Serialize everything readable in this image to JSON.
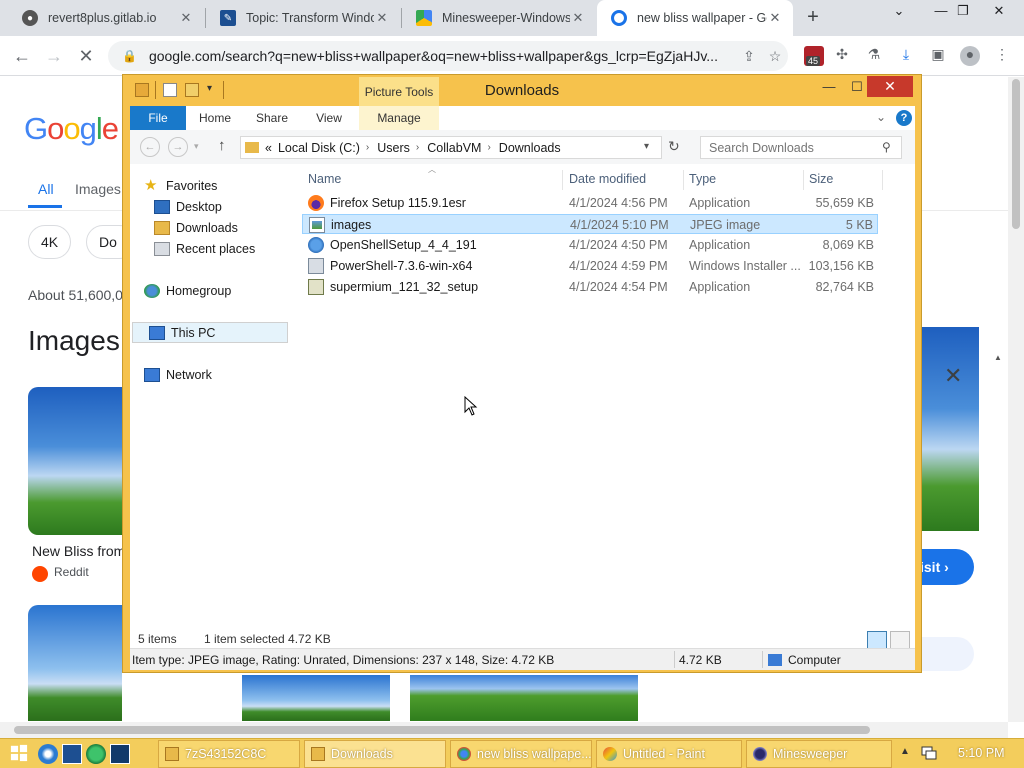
{
  "browser": {
    "tabs": [
      {
        "title": "revert8plus.gitlab.io",
        "active": false
      },
      {
        "title": "Topic: Transform Windo",
        "active": false
      },
      {
        "title": "Minesweeper-Windows",
        "active": false
      },
      {
        "title": "new bliss wallpaper - Go",
        "active": true
      }
    ],
    "new_tab": "+",
    "controls": {
      "minimize": "⌄",
      "restore": "—",
      "maximize": "❐",
      "close": "✕"
    },
    "url": "google.com/search?q=new+bliss+wallpaper&oq=new+bliss+wallpaper&gs_lcrp=EgZjaHJv...",
    "extension_badge": "45"
  },
  "google": {
    "logo": "Google",
    "tabs": [
      {
        "label": "All"
      },
      {
        "label": "Images"
      }
    ],
    "chips": [
      {
        "label": "4K"
      },
      {
        "label": "Do"
      }
    ],
    "results_count": "About 51,600,0",
    "section_title": "Images",
    "result_caption": "New Bliss from",
    "result_source": "Reddit",
    "visit_label": "isit ›"
  },
  "explorer": {
    "title": "Downloads",
    "contextual_tab": "Picture Tools",
    "ribbon_tabs": [
      {
        "label": "File"
      },
      {
        "label": "Home"
      },
      {
        "label": "Share"
      },
      {
        "label": "View"
      },
      {
        "label": "Manage"
      }
    ],
    "address": {
      "prefix": "«",
      "crumbs": [
        "Local Disk (C:)",
        "Users",
        "CollabVM",
        "Downloads"
      ]
    },
    "search_placeholder": "Search Downloads",
    "nav_pane": {
      "favorites": "Favorites",
      "desktop": "Desktop",
      "downloads": "Downloads",
      "recent": "Recent places",
      "homegroup": "Homegroup",
      "this_pc": "This PC",
      "network": "Network"
    },
    "columns": {
      "name": "Name",
      "date": "Date modified",
      "type": "Type",
      "size": "Size"
    },
    "files": [
      {
        "name": "Firefox Setup 115.9.1esr",
        "date": "4/1/2024 4:56 PM",
        "type": "Application",
        "size": "55,659 KB"
      },
      {
        "name": "images",
        "date": "4/1/2024 5:10 PM",
        "type": "JPEG image",
        "size": "5 KB"
      },
      {
        "name": "OpenShellSetup_4_4_191",
        "date": "4/1/2024 4:50 PM",
        "type": "Application",
        "size": "8,069 KB"
      },
      {
        "name": "PowerShell-7.3.6-win-x64",
        "date": "4/1/2024 4:59 PM",
        "type": "Windows Installer ...",
        "size": "103,156 KB"
      },
      {
        "name": "supermium_121_32_setup",
        "date": "4/1/2024 4:54 PM",
        "type": "Application",
        "size": "82,764 KB"
      }
    ],
    "selected_index": 1,
    "status": {
      "items": "5 items",
      "selected": "1 item selected  4.72 KB"
    },
    "details": {
      "info": "Item type: JPEG image, Rating: Unrated, Dimensions: 237 x 148, Size: 4.72 KB",
      "size": "4.72 KB",
      "location": "Computer"
    }
  },
  "taskbar": {
    "tasks": [
      {
        "label": "7zS43152C8C"
      },
      {
        "label": "Downloads"
      },
      {
        "label": "new bliss wallpape..."
      },
      {
        "label": "Untitled - Paint"
      },
      {
        "label": "Minesweeper"
      }
    ],
    "clock": "5:10 PM"
  }
}
